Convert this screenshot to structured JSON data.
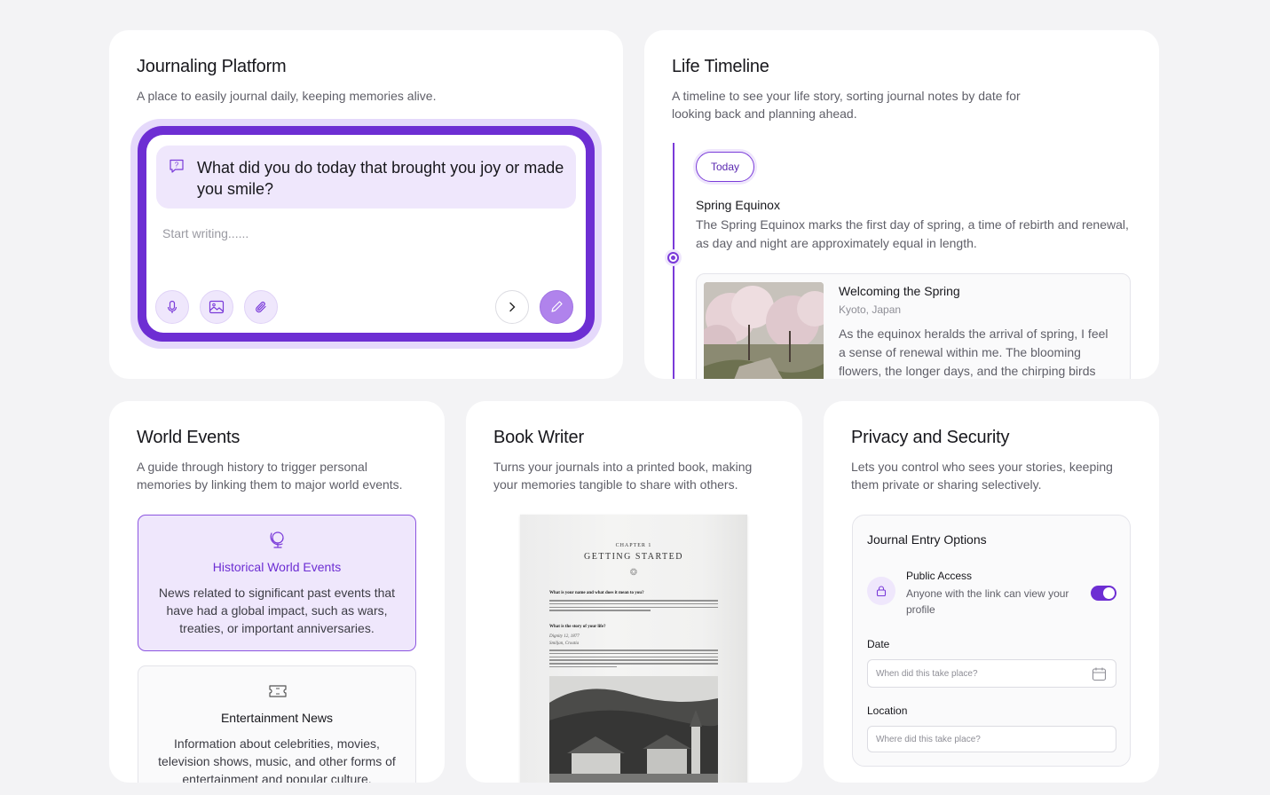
{
  "journal": {
    "title": "Journaling Platform",
    "description": "A place to easily journal daily, keeping memories alive.",
    "prompt": "What did you do today that brought you joy or made you smile?",
    "placeholder": "Start writing......",
    "icons": [
      "microphone-icon",
      "image-icon",
      "paperclip-icon",
      "chevron-right-icon",
      "pencil-icon"
    ]
  },
  "timeline": {
    "title": "Life Timeline",
    "description": "A timeline to see your life story, sorting journal notes by date for looking back and planning ahead.",
    "today_label": "Today",
    "event_title": "Spring Equinox",
    "event_body": "The Spring Equinox marks the first day of spring, a time of rebirth and renewal, as day and night are approximately equal in length.",
    "entry": {
      "title": "Welcoming the Spring",
      "location": "Kyoto, Japan",
      "body": "As the equinox heralds the arrival of spring, I feel a sense of renewal within me. The blooming flowers, the longer days, and the chirping birds seem to"
    }
  },
  "world": {
    "title": "World Events",
    "description": "A guide through history to trigger personal memories by linking them to major world events.",
    "cards": [
      {
        "title": "Historical World Events",
        "body": "News related to significant past events that have had a global impact, such as wars, treaties, or important anniversaries.",
        "icon": "globe-icon"
      },
      {
        "title": "Entertainment News",
        "body": "Information about celebrities, movies, television shows, music, and other forms of entertainment and popular culture.",
        "icon": "ticket-icon"
      }
    ]
  },
  "book": {
    "title": "Book Writer",
    "description": "Turns your journals into a printed book, making your memories tangible to share with others.",
    "chapter_label": "CHAPTER 1",
    "chapter_title": "GETTING STARTED",
    "question_1": "What is your name and what does it mean to you?",
    "question_2": "What is the story of your life?",
    "date_line": "Dignity 12, 1877",
    "place_line": "Smiljan, Croatia"
  },
  "privacy": {
    "title": "Privacy and Security",
    "description": "Lets you control who sees your stories, keeping them private or sharing selectively.",
    "box_title": "Journal Entry Options",
    "public_access_label": "Public Access",
    "public_access_desc": "Anyone with the link can view your profile",
    "public_access_on": true,
    "date_label": "Date",
    "date_placeholder": "When did this take place?",
    "location_label": "Location",
    "location_placeholder": "Where did this take place?"
  },
  "colors": {
    "accent": "#6d2ed3",
    "accent_light": "#efe7fc",
    "page_bg": "#f3f3f5"
  }
}
